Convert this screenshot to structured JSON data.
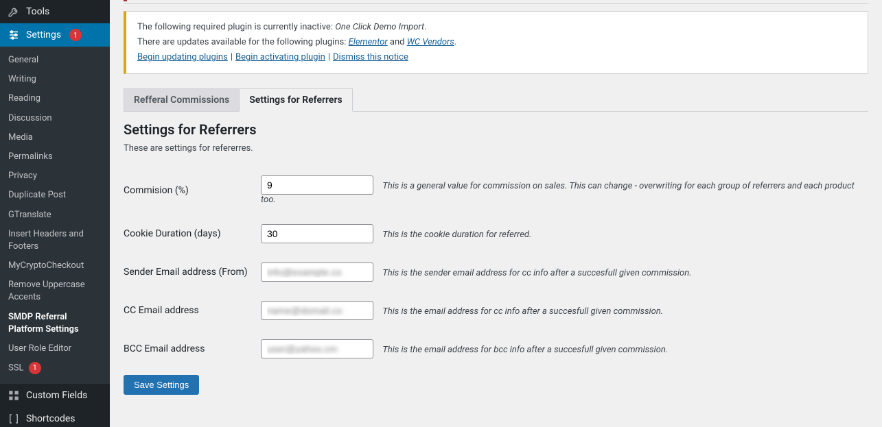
{
  "sidebar": {
    "tools_label": "Tools",
    "settings_label": "Settings",
    "settings_badge": "1",
    "submenu": [
      {
        "label": "General"
      },
      {
        "label": "Writing"
      },
      {
        "label": "Reading"
      },
      {
        "label": "Discussion"
      },
      {
        "label": "Media"
      },
      {
        "label": "Permalinks"
      },
      {
        "label": "Privacy"
      },
      {
        "label": "Duplicate Post"
      },
      {
        "label": "GTranslate"
      },
      {
        "label": "Insert Headers and Footers"
      },
      {
        "label": "MyCryptoCheckout"
      },
      {
        "label": "Remove Uppercase Accents"
      },
      {
        "label": "SMDP Referral Platform Settings",
        "current": true
      },
      {
        "label": "User Role Editor"
      },
      {
        "label": "SSL",
        "badge": "1"
      }
    ],
    "custom_fields_label": "Custom Fields",
    "shortcodes_label": "Shortcodes"
  },
  "notice": {
    "line1_pre": "The following required plugin is currently inactive: ",
    "line1_em": "One Click Demo Import",
    "line1_post": ".",
    "line2_pre": "There are updates available for the following plugins: ",
    "link_elementor": "Elementor",
    "and_text": " and ",
    "link_wcvendors": "WC Vendors",
    "line2_post": ".",
    "link_update": "Begin updating plugins",
    "link_activate": "Begin activating plugin",
    "link_dismiss": "Dismiss this notice"
  },
  "tabs": {
    "tab1": "Refferal Commissions",
    "tab2": "Settings for Referrers"
  },
  "page": {
    "title": "Settings for Referrers",
    "desc": "These are settings for refererres."
  },
  "form": {
    "commission": {
      "label": "Commision (%)",
      "value": "9",
      "desc": "This is a general value for commission on sales. This can change - overwriting for each group of referrers and each product too."
    },
    "cookie": {
      "label": "Cookie Duration (days)",
      "value": "30",
      "desc": "This is the cookie duration for referred."
    },
    "sender": {
      "label": "Sender Email address (From)",
      "value": "info@example.co",
      "desc": "This is the sender email address for cc info after a succesfull given commission."
    },
    "cc": {
      "label": "CC Email address",
      "value": "name@domail.co",
      "desc": "This is the email address for cc info after a succesfull given commission."
    },
    "bcc": {
      "label": "BCC Email address",
      "value": "user@yahoo.cm",
      "desc": "This is the email address for bcc info after a succesfull given commission."
    },
    "save": "Save Settings"
  }
}
